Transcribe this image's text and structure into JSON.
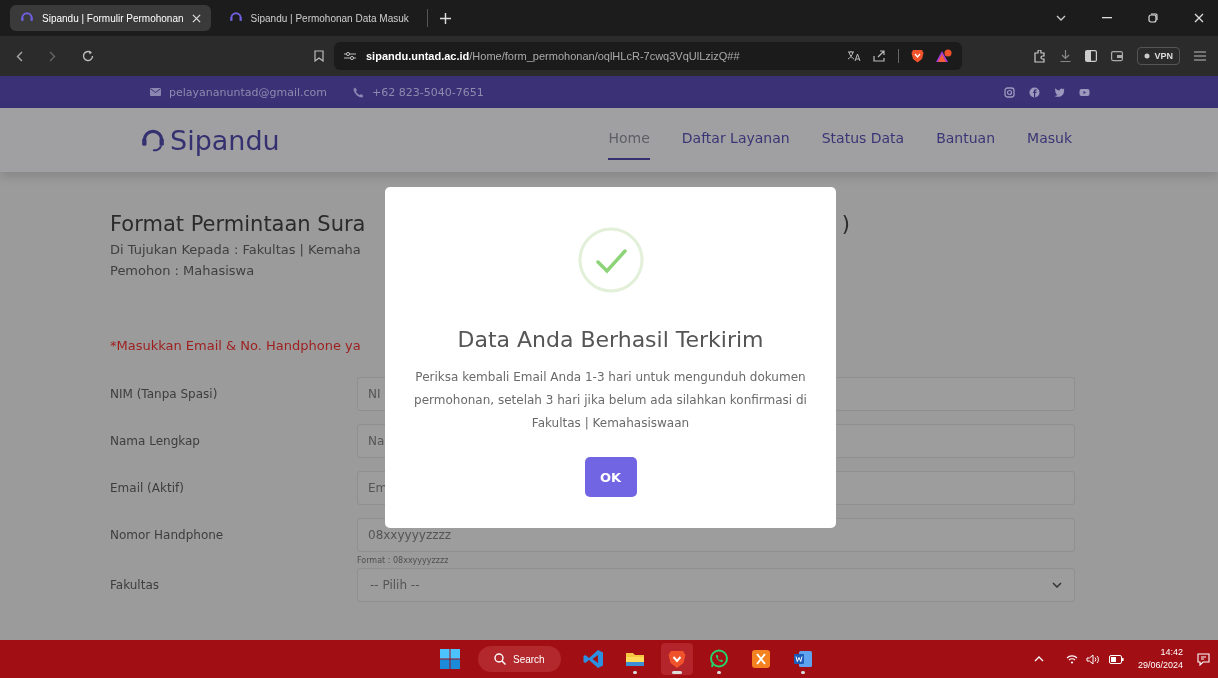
{
  "browser": {
    "tabs": [
      {
        "title": "Sipandu | Formulir Permohonan",
        "selected": true
      },
      {
        "title": "Sipandu | Permohonan Data Masuk",
        "selected": false
      }
    ],
    "url": "**sipandu.untad.ac.id**/Home/form_permohonan/oqlHLcR-7cwq3VqUlLzizQ##",
    "vpn": "VPN"
  },
  "topbar": {
    "email": "pelayananuntad@gmail.com",
    "phone": "+62 823-5040-7651",
    "socials": [
      {
        "kind": "instagram"
      },
      {
        "kind": "facebook"
      },
      {
        "kind": "twitter"
      },
      {
        "kind": "youtube"
      }
    ]
  },
  "navbar": {
    "brand": "Sipandu",
    "items": [
      {
        "label": "Home",
        "selected": true
      },
      {
        "label": "Daftar Layanan",
        "selected": false
      },
      {
        "label": "Status Data",
        "selected": false
      },
      {
        "label": "Bantuan",
        "selected": false
      },
      {
        "label": "Masuk",
        "selected": false
      }
    ]
  },
  "form": {
    "title": "Format Permintaan Sura",
    "title_end": ")",
    "recipient": "Di Tujukan Kepada : Fakultas | Kemaha",
    "applicant": "Pemohon : Mahasiswa",
    "notice": "*Masukkan Email & No. Handphone ya",
    "fields": [
      {
        "label": "NIM (Tanpa Spasi)",
        "kind": "text",
        "placeholder": "NI"
      },
      {
        "label": "Nama Lengkap",
        "kind": "text",
        "placeholder": "Na"
      },
      {
        "label": "Email (Aktif)",
        "kind": "text",
        "placeholder": "Em"
      },
      {
        "label": "Nomor Handphone",
        "kind": "text",
        "placeholder": "08xxyyyyzzzz",
        "hint": "Format : 08xxyyyyzzzz"
      },
      {
        "label": "Fakultas",
        "kind": "select",
        "value": "-- Pilih --"
      }
    ]
  },
  "dialog": {
    "title": "Data Anda Berhasil Terkirim",
    "message": "Periksa kembali Email Anda 1-3 hari untuk mengunduh dokumen permohonan, setelah 3 hari jika belum ada silahkan konfirmasi di Fakultas | Kemahasiswaan",
    "button": "OK"
  },
  "taskbar": {
    "search": "Search",
    "apps": [
      {
        "kind": "code",
        "running": false,
        "active": false
      },
      {
        "kind": "folder",
        "running": true,
        "active": false
      },
      {
        "kind": "brave",
        "running": true,
        "active": true
      },
      {
        "kind": "whatsapp",
        "running": true,
        "active": false
      },
      {
        "kind": "xampp",
        "running": false,
        "active": false
      },
      {
        "kind": "word",
        "running": true,
        "active": false
      }
    ],
    "time": "14:42",
    "date": "29/06/2024"
  }
}
